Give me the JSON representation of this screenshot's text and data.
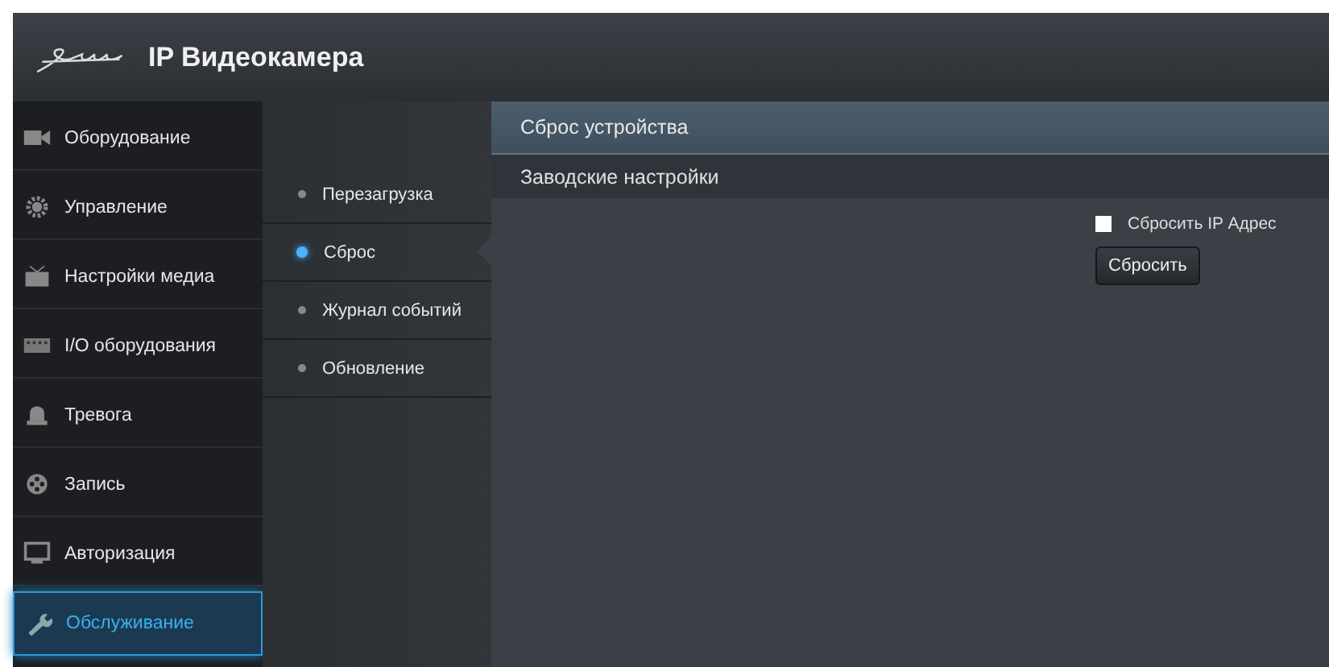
{
  "header": {
    "title": "IP Видеокамера"
  },
  "nav": [
    {
      "label": "Оборудование",
      "kind": "camera",
      "selected": false
    },
    {
      "label": "Управление",
      "kind": "gear",
      "selected": false
    },
    {
      "label": "Настройки медиа",
      "kind": "media",
      "selected": false
    },
    {
      "label": "I/O оборудования",
      "kind": "io",
      "selected": false
    },
    {
      "label": "Тревога",
      "kind": "alarm",
      "selected": false
    },
    {
      "label": "Запись",
      "kind": "reel",
      "selected": false
    },
    {
      "label": "Авторизация",
      "kind": "monitor",
      "selected": false
    },
    {
      "label": "Обслуживание",
      "kind": "wrench",
      "selected": true
    }
  ],
  "subnav": [
    {
      "label": "Перезагрузка",
      "selected": false
    },
    {
      "label": "Сброс",
      "selected": true
    },
    {
      "label": "Журнал событий",
      "selected": false
    },
    {
      "label": "Обновление",
      "selected": false
    }
  ],
  "panel": {
    "title": "Сброс устройства",
    "section": "Заводские настройки",
    "checkbox": {
      "label": "Сбросить IP Адрес",
      "checked": false
    },
    "button": "Сбросить"
  }
}
